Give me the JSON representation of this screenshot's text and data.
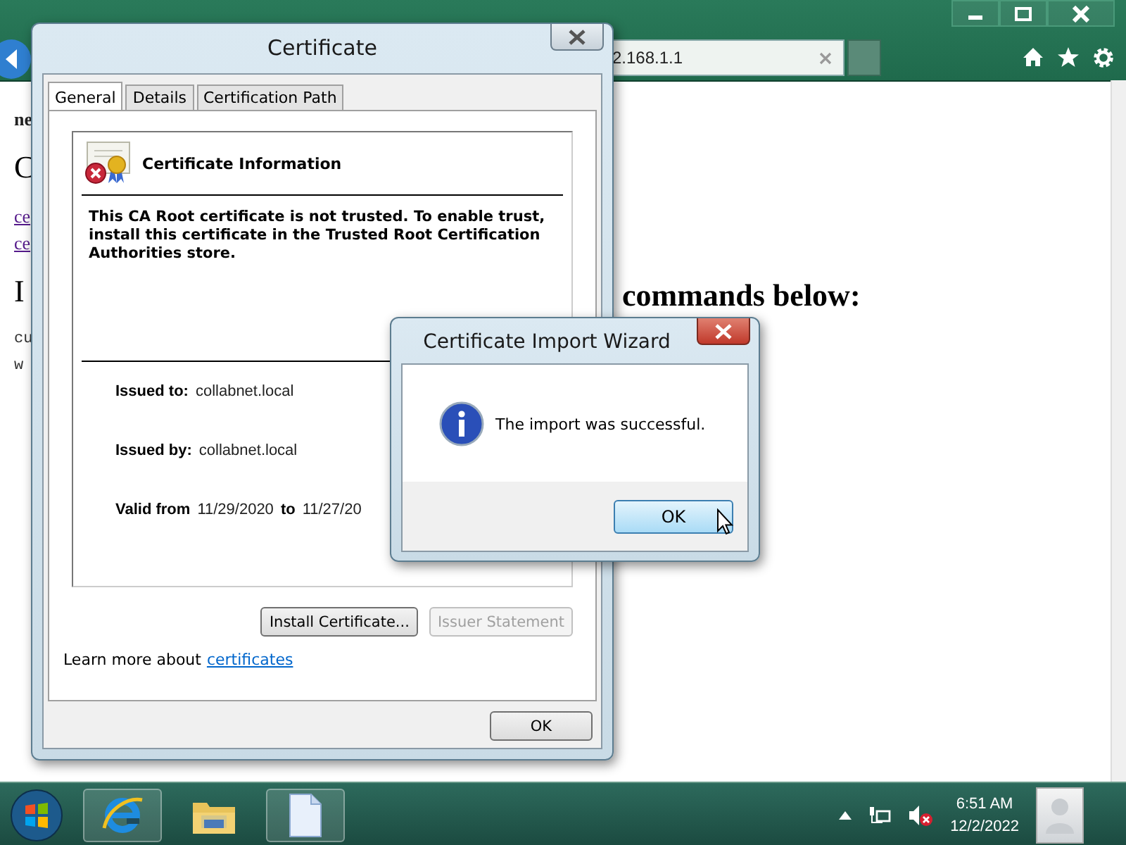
{
  "browser": {
    "tab": {
      "title": "2.168.1.1"
    },
    "fragments": [
      {
        "kind": "text",
        "text": "ne"
      },
      {
        "kind": "heading",
        "text": "C"
      },
      {
        "kind": "link",
        "text": "ce"
      },
      {
        "kind": "link",
        "text": "ce"
      },
      {
        "kind": "heading",
        "text": "I"
      },
      {
        "kind": "code",
        "text": "cu"
      },
      {
        "kind": "code",
        "text": "w"
      }
    ],
    "heading_right": "commands below:"
  },
  "certificate_dialog": {
    "title": "Certificate",
    "tabs": [
      {
        "label": "General",
        "selected": true
      },
      {
        "label": "Details",
        "selected": false
      },
      {
        "label": "Certification Path",
        "selected": false
      }
    ],
    "heading": "Certificate Information",
    "message": "This CA Root certificate is not trusted. To enable trust, install this certificate in the Trusted Root Certification Authorities store.",
    "fields": [
      {
        "label": "Issued to:",
        "value": "collabnet.local"
      },
      {
        "label": "Issued by:",
        "value": "collabnet.local"
      }
    ],
    "validity": {
      "label": "Valid from",
      "from": "11/29/2020",
      "to_label": "to",
      "to": "11/27/20"
    },
    "buttons": [
      {
        "label": "Install Certificate...",
        "disabled": false
      },
      {
        "label": "Issuer Statement",
        "disabled": true
      }
    ],
    "learn_more": {
      "text": "Learn more about",
      "link": "certificates"
    },
    "ok": "OK"
  },
  "wizard": {
    "title": "Certificate Import Wizard",
    "message": "The import was successful.",
    "ok": "OK"
  },
  "taskbar": {
    "time": "6:51 AM",
    "date": "12/2/2022"
  }
}
